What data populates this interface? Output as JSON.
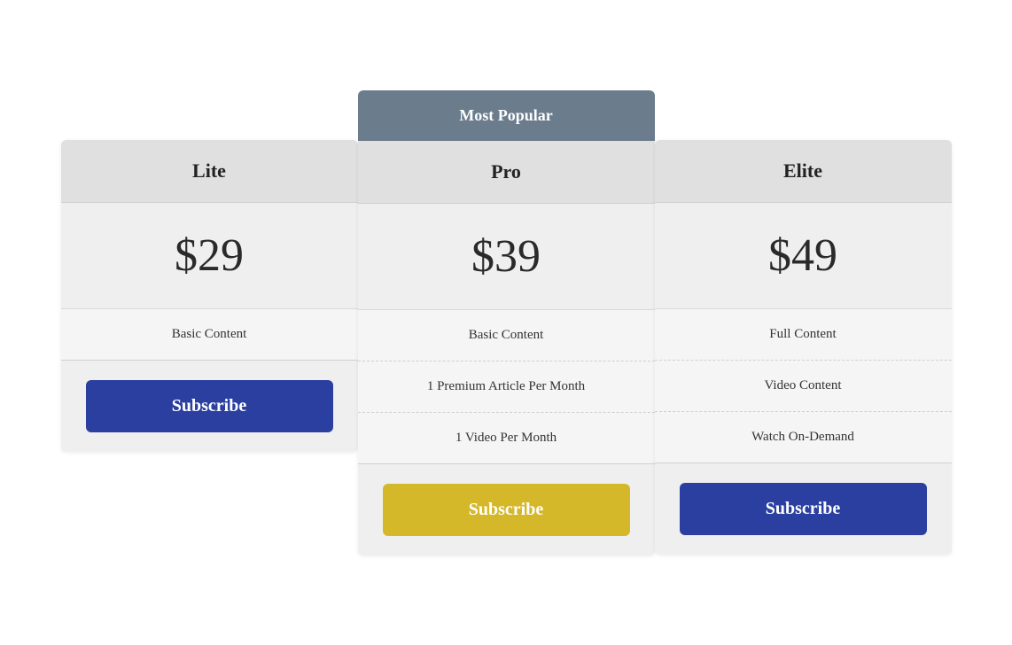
{
  "badge": {
    "label": "Most Popular"
  },
  "plans": [
    {
      "id": "lite",
      "name": "Lite",
      "price": "$29",
      "features": [
        "Basic Content"
      ],
      "button_label": "Subscribe",
      "button_style": "blue",
      "is_popular": false
    },
    {
      "id": "pro",
      "name": "Pro",
      "price": "$39",
      "features": [
        "Basic Content",
        "1 Premium Article Per Month",
        "1 Video Per Month"
      ],
      "button_label": "Subscribe",
      "button_style": "yellow",
      "is_popular": true
    },
    {
      "id": "elite",
      "name": "Elite",
      "price": "$49",
      "features": [
        "Full Content",
        "Video Content",
        "Watch On-Demand"
      ],
      "button_label": "Subscribe",
      "button_style": "blue",
      "is_popular": false
    }
  ]
}
